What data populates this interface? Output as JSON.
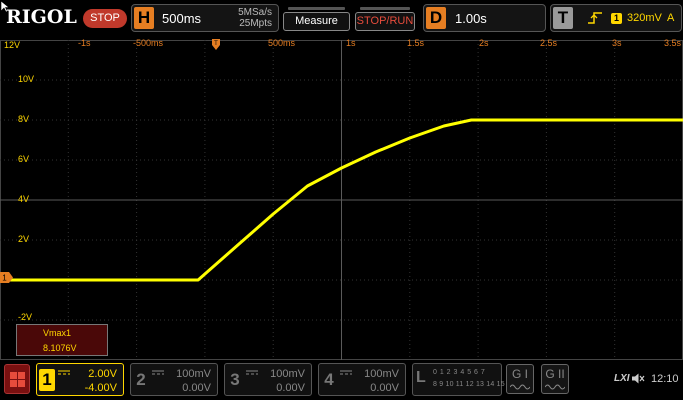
{
  "brand": {
    "logo": "RIGOL",
    "run_state": "STOP"
  },
  "horizontal": {
    "badge": "H",
    "timebase": "500ms",
    "sample_rate": "5MSa/s",
    "memory_depth": "25Mpts"
  },
  "buttons": {
    "measure": "Measure",
    "stop_run": "STOP/RUN"
  },
  "delay": {
    "badge": "D",
    "value": "1.00s"
  },
  "trigger": {
    "badge": "T",
    "source_channel": "1",
    "level": "320mV",
    "mode": "A"
  },
  "grid": {
    "x_labels": [
      "-1s",
      "-500ms",
      "500ms",
      "1s",
      "1.5s",
      "2s",
      "2.5s",
      "3s",
      "3.5s"
    ],
    "y_labels": [
      "12V",
      "10V",
      "8V",
      "6V",
      "4V",
      "2V",
      "-2V"
    ],
    "ground_marker": "1"
  },
  "chart_data": {
    "type": "line",
    "xlabel": "",
    "ylabel": "",
    "xlim": [
      -1.5,
      3.5
    ],
    "ylim": [
      -4,
      12
    ],
    "series": [
      {
        "color": "#ffff00",
        "x": [
          -1.5,
          -0.05,
          0.0,
          0.25,
          0.5,
          0.75,
          1.0,
          1.25,
          1.5,
          1.75,
          1.95,
          2.0,
          3.5
        ],
        "y": [
          0.0,
          0.0,
          0.3,
          1.8,
          3.3,
          4.7,
          5.6,
          6.4,
          7.1,
          7.7,
          8.0,
          8.0,
          8.0
        ]
      }
    ]
  },
  "measurement": {
    "name": "Vmax1",
    "value": "8.1076V"
  },
  "channels": [
    {
      "number": "1",
      "scale": "2.00V",
      "offset": "-4.00V",
      "active": true
    },
    {
      "number": "2",
      "scale": "100mV",
      "offset": "0.00V",
      "active": false
    },
    {
      "number": "3",
      "scale": "100mV",
      "offset": "0.00V",
      "active": false
    },
    {
      "number": "4",
      "scale": "100mV",
      "offset": "0.00V",
      "active": false
    }
  ],
  "logic_analyzer": {
    "label": "L",
    "row1": "0 1 2 3 4 5 6 7",
    "row2": "8 9 10 11 12 13 14 15"
  },
  "generators": [
    "G I",
    "G II"
  ],
  "status": {
    "lxi": "LXI",
    "time": "12:10"
  },
  "colors": {
    "ch1": "#ffd700",
    "trace": "#ffff00",
    "accent": "#e67e22",
    "stop": "#c0392b"
  }
}
